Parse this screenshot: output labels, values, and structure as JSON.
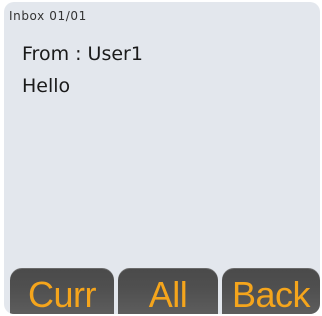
{
  "header": {
    "title": "Inbox 01/01"
  },
  "message": {
    "from_line": "From : User1",
    "body": "Hello"
  },
  "softkeys": {
    "left_label": "Curr",
    "middle_label": "All",
    "right_label": "Back"
  },
  "colors": {
    "panel_background": "#e3e7ed",
    "softkey_background": "#4f4f4f",
    "softkey_text": "#f5a51c"
  }
}
